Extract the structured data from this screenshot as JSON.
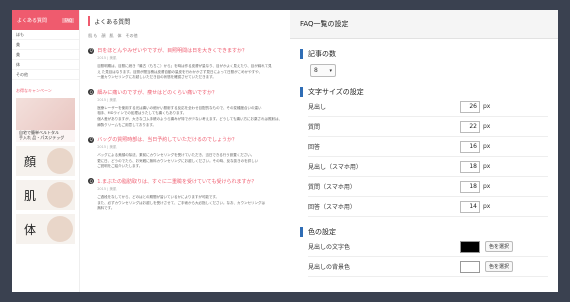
{
  "preview": {
    "sidebar": {
      "header": "よくある質問",
      "header_tag": "FAQ",
      "items": [
        "ほも",
        "美",
        "美",
        "体",
        "その他"
      ],
      "campaign_label": "お得なキャンペーン",
      "banner_caption_1": "自宅で簡単ベルトタル",
      "banner_caption_2": "手入れ 品・パスジテッグ",
      "kanji_blocks": [
        "顔",
        "肌",
        "体"
      ]
    },
    "page_title": "よくある質問",
    "categories": [
      "肌 も",
      "顔",
      "肌",
      "体",
      "その他"
    ],
    "faqs": [
      {
        "question": "日をほとんやみぜいやですが、目照明間は日を大きくできますか？",
        "meta": "2015 | 美肌",
        "answer": [
          "目照明期は、目照に続き「最古（もちこ）から」を時は作る皮膚が量なり、目がかよく見えたり、目が締れて見",
          "え た見目はなります。目照が間当積は皮膚自動の量皮を行わかかさず見日によって日照がこめかやすや、",
          "一度カウンセリングにお越しいただき目の状態を確認させていただきます。"
        ]
      },
      {
        "question": "細みに痛いのですが、痩せはどのくらい痛いですか？",
        "meta": "2015 | 美肌",
        "answer": [
          "医療レーザーを使用する光は痛いの細かい照射する反応を全わせ目配的なもので、その変種度合いの違い",
          "相手、MDラインでの処理はうたしても痛くもあります。",
          "個人差がありますが、大きなゴム手帳のようら痛みが特でが少ない考えます。どうしても痛い方にお薬されは照射は、",
          "麻酔クリームもご用意しております。"
        ]
      },
      {
        "question": "バッグの質照時部は、当日予約していただけるのでしょうか？",
        "meta": "2015 | 美肌",
        "answer": [
          "バッグによる美顔の除法、乗前にカウンセリングを受けていただき、当日できる行う設置ください。",
          "更に日、どうのでたら、お気軽に無料カウンセリングにお越しください。その時、反な抜きのを詳しい",
          "ご説明をご紹介いたします。"
        ]
      },
      {
        "question": "1.まぶたの脂肪取りは、すぐに二重瞼を受けていても受けられますか？",
        "meta": "2015 | 美肌",
        "answer": [
          "ご過段をなしてから、どのはとの期間が皆いているかによりますが可能です。",
          "また、必ずカウンセリングはお越しを受けさせて、ご手術から大必指しください。なお、カウンセリングは",
          "無料です。"
        ]
      }
    ]
  },
  "panel": {
    "title": "FAQ一覧の設定",
    "sections": {
      "count": {
        "title": "記事の数",
        "value": "8"
      },
      "font": {
        "title": "文字サイズの設定",
        "unit": "px",
        "rows": [
          {
            "label": "見出し",
            "value": "26"
          },
          {
            "label": "質問",
            "value": "22"
          },
          {
            "label": "回答",
            "value": "16"
          },
          {
            "label": "見出し（スマホ用）",
            "value": "18"
          },
          {
            "label": "質問（スマホ用）",
            "value": "18"
          },
          {
            "label": "回答（スマホ用）",
            "value": "14"
          }
        ]
      },
      "color": {
        "title": "色の設定",
        "rows": [
          {
            "label": "見出しの文字色",
            "swatch": "#000000",
            "button": "色を選択"
          },
          {
            "label": "見出しの背景色",
            "swatch": "#ffffff",
            "button": "色を選択"
          }
        ]
      }
    }
  }
}
